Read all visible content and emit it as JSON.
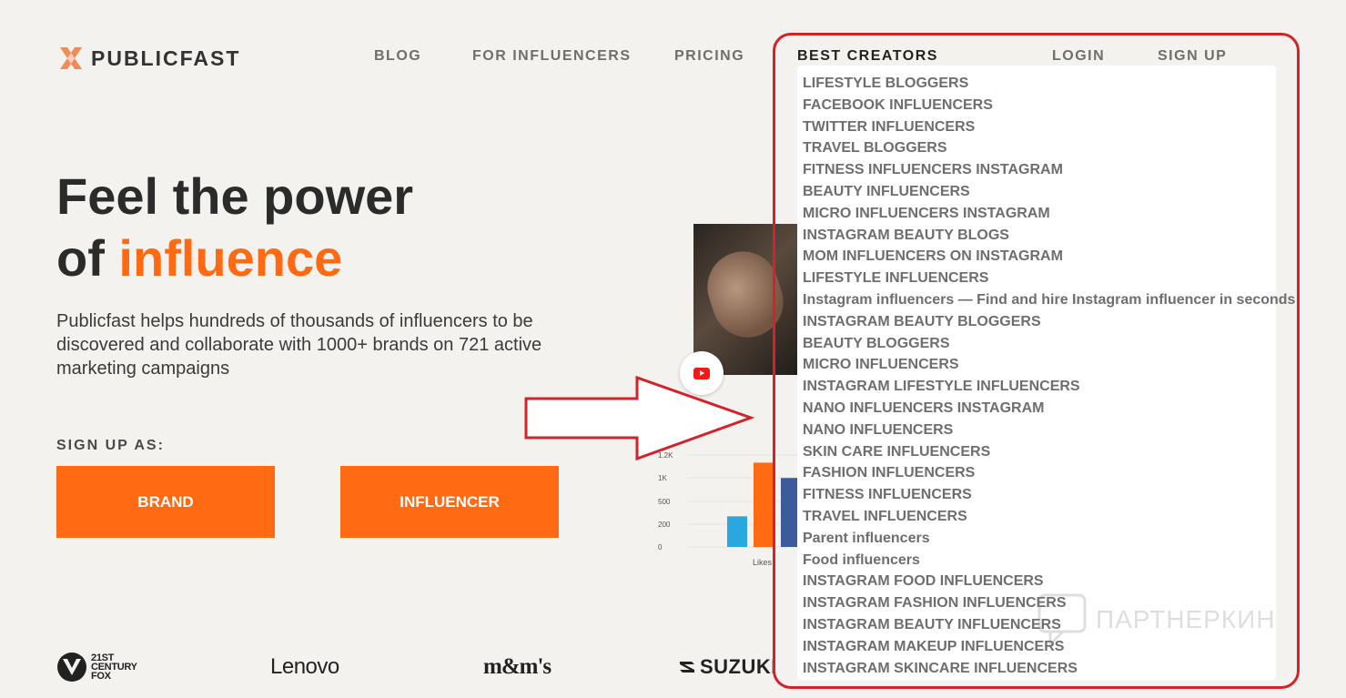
{
  "brand_name": "PUBLICFAST",
  "nav": {
    "blog": "BLOG",
    "for_influencers": "FOR INFLUENCERS",
    "pricing": "PRICING",
    "best_creators": "BEST CREATORS",
    "login": "LOGIN",
    "signup": "SIGN UP"
  },
  "hero": {
    "title_line1": "Feel the power",
    "title_line2_prefix": "of ",
    "title_line2_accent": "influence",
    "description": "Publicfast helps hundreds of thousands of influencers to be discovered and collaborate with 1000+ brands on 721 active marketing campaigns",
    "signup_label": "SIGN UP AS:",
    "brand_button": "BRAND",
    "influencer_button": "INFLUENCER"
  },
  "chart_data": {
    "type": "bar",
    "yticks": [
      "1.2K",
      "1K",
      "500",
      "200",
      "0"
    ],
    "categories": [
      "Likes"
    ],
    "bars": [
      {
        "value": 400,
        "color": "#29a8e0"
      },
      {
        "value": 1100,
        "color": "#ff6a13"
      },
      {
        "value": 900,
        "color": "#3b5b9a"
      }
    ],
    "ylim": [
      0,
      1200
    ]
  },
  "brands": {
    "fox_line1": "21ST",
    "fox_line2": "CENTURY",
    "fox_line3": "FOX",
    "lenovo": "Lenovo",
    "mms": "m&m's",
    "suzuki": "SUZUKI"
  },
  "dropdown": {
    "items": [
      "LIFESTYLE BLOGGERS",
      "FACEBOOK INFLUENCERS",
      "TWITTER INFLUENCERS",
      "TRAVEL BLOGGERS",
      "FITNESS INFLUENCERS INSTAGRAM",
      "BEAUTY INFLUENCERS",
      "MICRO INFLUENCERS INSTAGRAM",
      "INSTAGRAM BEAUTY BLOGS",
      "MOM INFLUENCERS ON INSTAGRAM",
      "LIFESTYLE INFLUENCERS",
      "Instagram influencers — Find and hire Instagram influencer in seconds",
      "INSTAGRAM BEAUTY BLOGGERS",
      "BEAUTY BLOGGERS",
      "MICRO INFLUENCERS",
      "INSTAGRAM LIFESTYLE INFLUENCERS",
      "NANO INFLUENCERS INSTAGRAM",
      "NANO INFLUENCERS",
      "SKIN CARE INFLUENCERS",
      "FASHION INFLUENCERS",
      "FITNESS INFLUENCERS",
      "TRAVEL INFLUENCERS",
      "Parent influencers",
      "Food influencers",
      "INSTAGRAM FOOD INFLUENCERS",
      "INSTAGRAM FASHION INFLUENCERS",
      "INSTAGRAM BEAUTY INFLUENCERS",
      "INSTAGRAM MAKEUP INFLUENCERS",
      "INSTAGRAM SKINCARE INFLUENCERS"
    ]
  },
  "watermark": "ПАРТНЕРКИН",
  "colors": {
    "accent": "#ff6a13",
    "annotation_red": "#d4222a",
    "background": "#f4f2ef"
  }
}
